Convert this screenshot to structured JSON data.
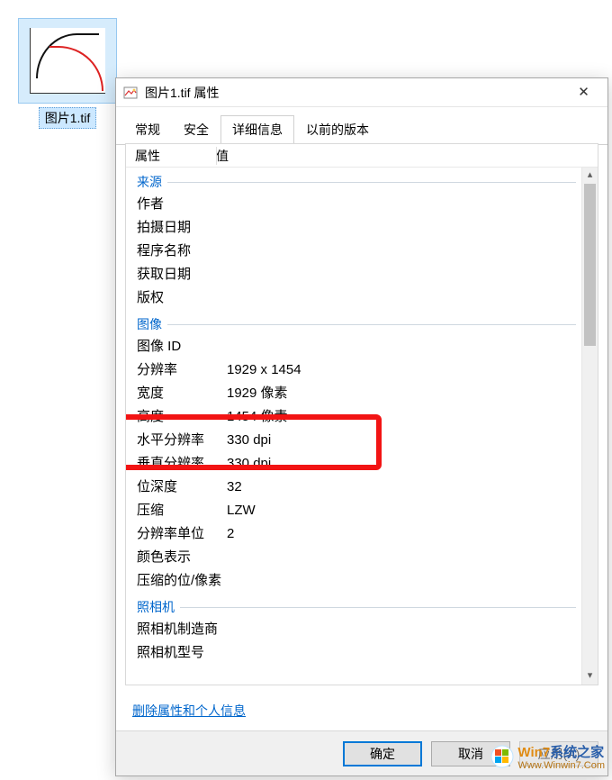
{
  "desktop": {
    "file_label": "图片1.tif"
  },
  "dialog": {
    "title": "图片1.tif 属性",
    "tabs": [
      "常规",
      "安全",
      "详细信息",
      "以前的版本"
    ],
    "active_tab_index": 2,
    "columns": {
      "property": "属性",
      "value": "值"
    },
    "sections": {
      "source": {
        "header": "来源",
        "rows": [
          {
            "k": "作者",
            "v": ""
          },
          {
            "k": "拍摄日期",
            "v": ""
          },
          {
            "k": "程序名称",
            "v": ""
          },
          {
            "k": "获取日期",
            "v": ""
          },
          {
            "k": "版权",
            "v": ""
          }
        ]
      },
      "image": {
        "header": "图像",
        "rows": [
          {
            "k": "图像 ID",
            "v": ""
          },
          {
            "k": "分辨率",
            "v": "1929 x 1454"
          },
          {
            "k": "宽度",
            "v": "1929 像素"
          },
          {
            "k": "高度",
            "v": "1454 像素"
          },
          {
            "k": "水平分辨率",
            "v": "330 dpi"
          },
          {
            "k": "垂直分辨率",
            "v": "330 dpi"
          },
          {
            "k": "位深度",
            "v": "32"
          },
          {
            "k": "压缩",
            "v": "LZW"
          },
          {
            "k": "分辨率单位",
            "v": "2"
          },
          {
            "k": "颜色表示",
            "v": ""
          },
          {
            "k": "压缩的位/像素",
            "v": ""
          }
        ]
      },
      "camera": {
        "header": "照相机",
        "rows": [
          {
            "k": "照相机制造商",
            "v": ""
          },
          {
            "k": "照相机型号",
            "v": ""
          }
        ]
      }
    },
    "remove_link": "删除属性和个人信息",
    "buttons": {
      "ok": "确定",
      "cancel": "取消",
      "apply": "应用(A)"
    }
  },
  "watermark": {
    "brand1": "Win7",
    "brand2": "系统之家",
    "url": "Www.Winwin7.Com"
  }
}
